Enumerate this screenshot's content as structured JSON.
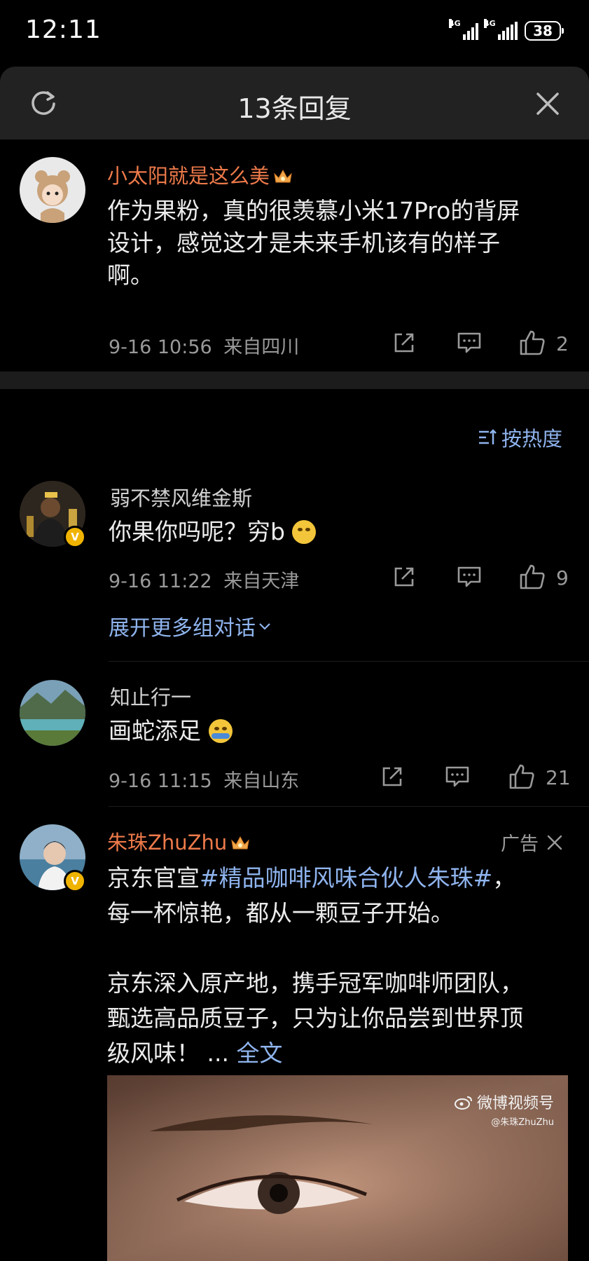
{
  "status": {
    "time": "12:11",
    "battery": "38",
    "net1": "4G",
    "net2": "4G"
  },
  "header": {
    "title": "13条回复",
    "refresh_icon": "refresh-icon",
    "close_icon": "close-icon"
  },
  "root_comment": {
    "user": "小太阳就是这么美",
    "text_lines": [
      "作为果粉，真的很羡慕小米17Pro的背屏",
      "设计，感觉这才是未来手机该有的样子",
      "啊。"
    ],
    "time": "9-16 10:56",
    "location": "来自四川",
    "likes": "2"
  },
  "sort": {
    "label": "按热度"
  },
  "replies": [
    {
      "user": "弱不禁风维金斯",
      "text": "你果你吗呢？穷b",
      "time": "9-16 11:22",
      "location": "来自天津",
      "likes": "9",
      "expand": "展开更多组对话"
    },
    {
      "user": "知止行一",
      "text": "画蛇添足",
      "time": "9-16 11:15",
      "location": "来自山东",
      "likes": "21"
    }
  ],
  "ad": {
    "user": "朱珠ZhuZhu",
    "ad_label": "广告",
    "line1_prefix": "京东官宣",
    "hashtag": "#精品咖啡风味合伙人朱珠#",
    "line1_suffix": "，",
    "line2": "每一杯惊艳，都从一颗豆子开始。",
    "line3": "京东深入原产地，携手冠军咖啡师团队，",
    "line4": "甄选高品质豆子，只为让你品尝到世界顶",
    "line5_prefix": "级风味！ ... ",
    "full_text": "全文",
    "watermark": "微博视频号",
    "watermark_handle": "@朱珠ZhuZhu"
  },
  "colors": {
    "header_bg": "#222222",
    "name_orange": "#ee7a4a",
    "link_blue": "#8fb4ee",
    "meta_gray": "#9a9a9a"
  }
}
